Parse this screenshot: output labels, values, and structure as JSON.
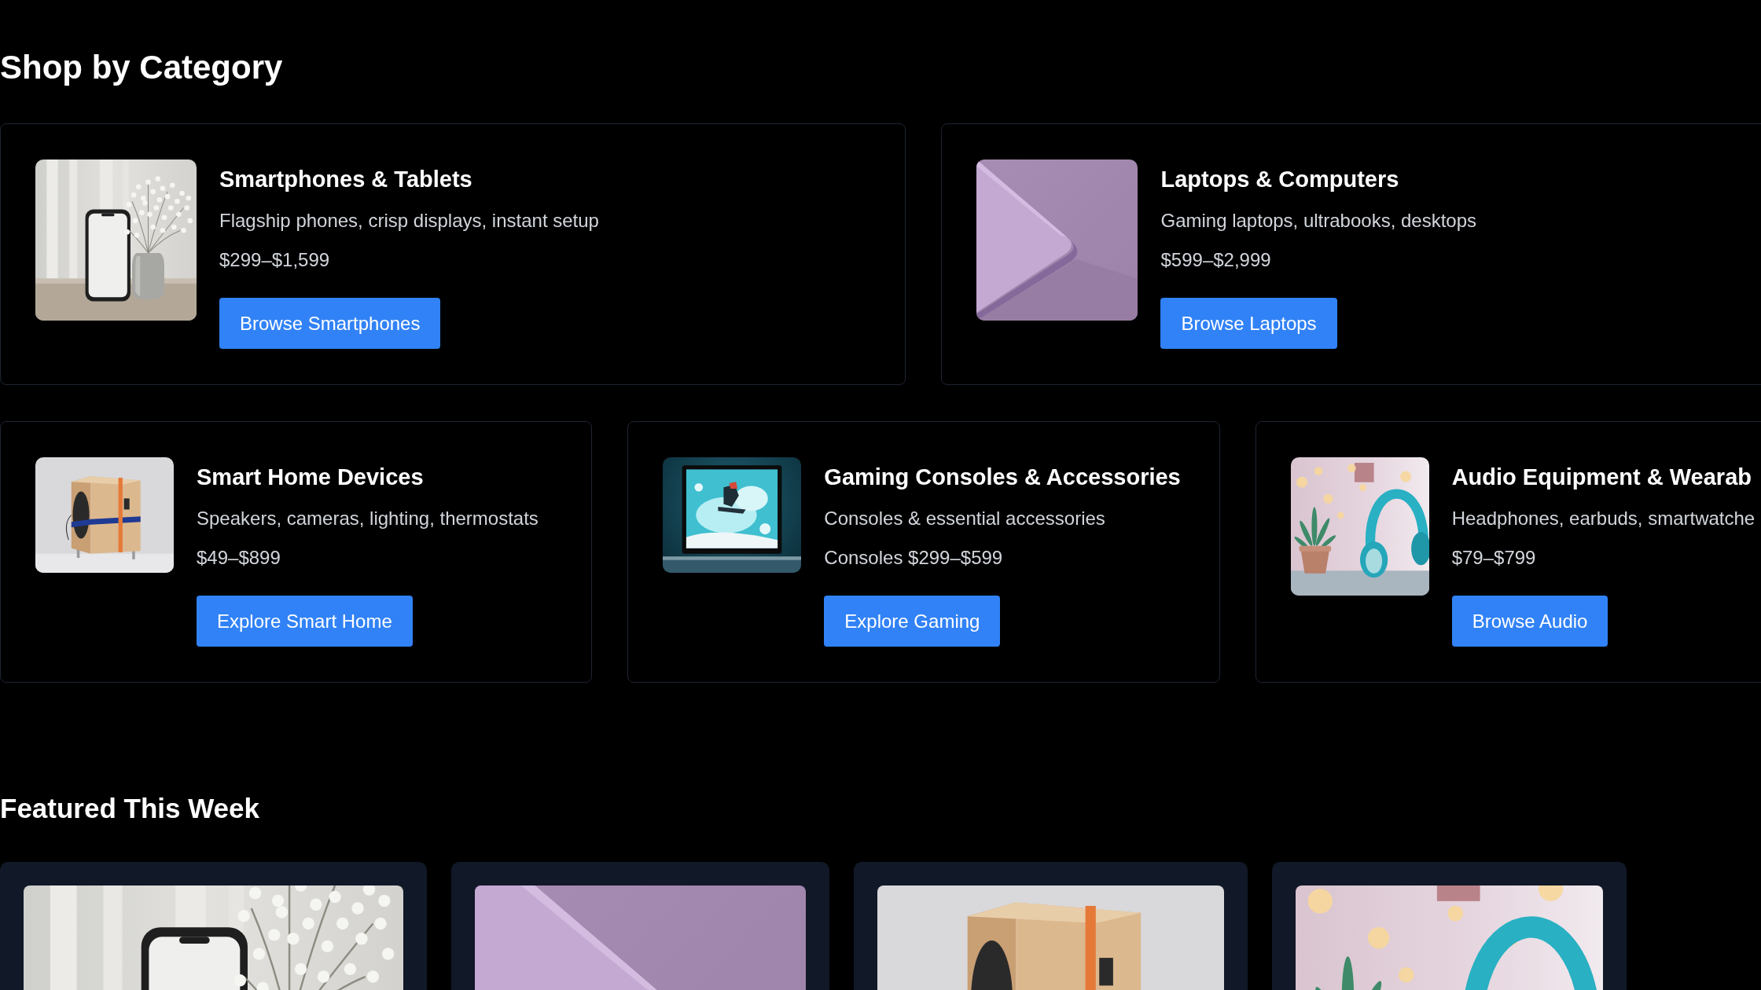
{
  "shop_by_category": {
    "heading": "Shop by Category",
    "cards": [
      {
        "title": "Smartphones & Tablets",
        "description": "Flagship phones, crisp displays, instant setup",
        "price": "$299–$1,599",
        "button": "Browse Smartphones"
      },
      {
        "title": "Laptops & Computers",
        "description": "Gaming laptops, ultrabooks, desktops",
        "price": "$599–$2,999",
        "button": "Browse Laptops"
      },
      {
        "title": "Smart Home Devices",
        "description": "Speakers, cameras, lighting, thermostats",
        "price": "$49–$899",
        "button": "Explore Smart Home"
      },
      {
        "title": "Gaming Consoles & Accessories",
        "description": "Consoles & essential accessories",
        "price": "Consoles $299–$599",
        "button": "Explore Gaming"
      },
      {
        "title": "Audio Equipment & Wearab",
        "description": "Headphones, earbuds, smartwatche",
        "price": "$79–$799",
        "button": "Browse Audio"
      }
    ]
  },
  "featured_this_week": {
    "heading": "Featured This Week"
  }
}
